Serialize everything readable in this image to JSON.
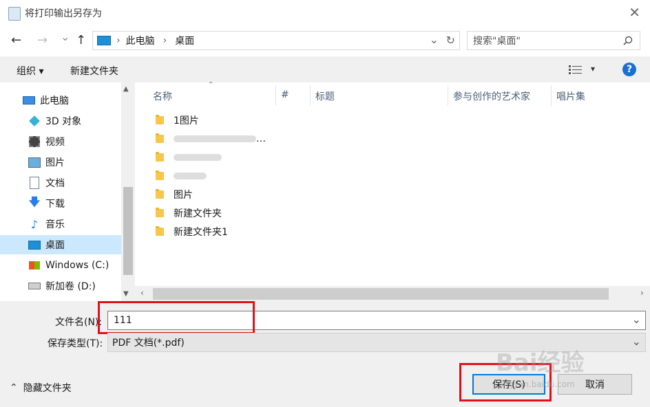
{
  "window": {
    "title": "将打印输出另存为",
    "close_glyph": "✕"
  },
  "nav": {
    "back": "←",
    "forward": "→",
    "recent": "⌄",
    "up": "↑",
    "path": [
      "此电脑",
      "桌面"
    ],
    "sep": "›",
    "dropdown": "⌄",
    "refresh": "↻",
    "search_placeholder": "搜索\"桌面\""
  },
  "toolbar": {
    "organize": "组织 ▾",
    "new_folder": "新建文件夹",
    "help": "?",
    "view": "▾"
  },
  "sidebar": {
    "items": [
      {
        "label": "此电脑",
        "icon": "pc-icon"
      },
      {
        "label": "3D 对象",
        "icon": "3d-objects-icon"
      },
      {
        "label": "视频",
        "icon": "video-icon"
      },
      {
        "label": "图片",
        "icon": "pictures-icon"
      },
      {
        "label": "文档",
        "icon": "documents-icon"
      },
      {
        "label": "下载",
        "icon": "download-icon"
      },
      {
        "label": "音乐",
        "icon": "music-icon"
      },
      {
        "label": "桌面",
        "icon": "desktop-icon",
        "selected": true
      },
      {
        "label": "Windows (C:)",
        "icon": "drive-c-icon"
      },
      {
        "label": "新加卷 (D:)",
        "icon": "drive-d-icon"
      }
    ]
  },
  "columns": {
    "name": "名称",
    "num": "#",
    "title": "标题",
    "artist": "参与创作的艺术家",
    "album": "唱片集"
  },
  "files": [
    {
      "label": "1图片"
    },
    {
      "label": "…",
      "blurred": true
    },
    {
      "label": "",
      "blurred": true
    },
    {
      "label": "",
      "blurred": true
    },
    {
      "label": "图片"
    },
    {
      "label": "新建文件夹"
    },
    {
      "label": "新建文件夹1"
    }
  ],
  "save": {
    "filename_label": "文件名(N):",
    "filename_value": "111",
    "type_label": "保存类型(T):",
    "type_value": "PDF 文档(*.pdf)",
    "hide_folders": "隐藏文件夹",
    "hide_glyph": "⌃",
    "save_button": "保存(S)",
    "cancel_button": "取消"
  },
  "watermark": {
    "brand": "Bai经验",
    "url": "jingyan.baidu.com"
  },
  "colors": {
    "selection": "#cce8ff",
    "highlight": "#e0101a",
    "help": "#1a6fd1"
  }
}
